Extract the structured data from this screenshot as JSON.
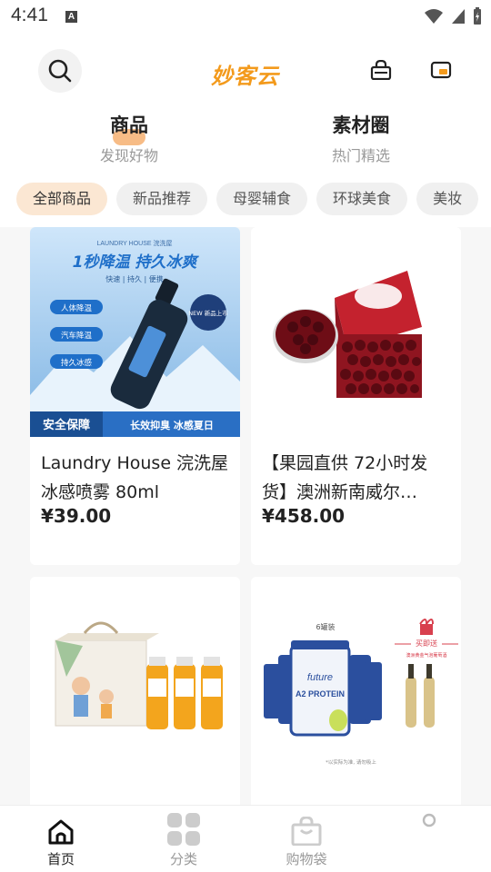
{
  "status": {
    "time": "4:41",
    "notif_glyph": "A"
  },
  "header": {
    "logo": "妙客云"
  },
  "main_tabs": [
    {
      "title": "商品",
      "subtitle": "发现好物"
    },
    {
      "title": "素材圈",
      "subtitle": "热门精选"
    }
  ],
  "chips": [
    "全部商品",
    "新品推荐",
    "母婴辅食",
    "环球美食",
    "美妆"
  ],
  "products": [
    {
      "title": "Laundry House 浣洗屋 冰感喷雾 80ml",
      "price": "¥39.00",
      "img": {
        "brand": "LAUNDRY HOUSE 浣洗屋",
        "headline": "1秒降温 持久冰爽",
        "sub": "快速 | 持久 | 便携",
        "tags": [
          "人体降温",
          "汽车降温",
          "持久冰感"
        ],
        "badge": "NEW 新品上市",
        "footer_left": "安全保障",
        "footer_right": "长效抑臭 冰感夏日"
      }
    },
    {
      "title": "【果园直供 72小时发货】澳洲新南威尔…",
      "price": "¥458.00",
      "img": {}
    },
    {
      "title": "",
      "price": "",
      "img": {}
    },
    {
      "title": "",
      "price": "",
      "img": {
        "top_label": "6罐装",
        "can_brand": "future",
        "can_text": "A2 PROTEIN",
        "gift": "买即送",
        "gift_sub": "澳洲黄金气泡葡萄酒",
        "footnote": "*以实际为准, 请勿吸上"
      }
    }
  ],
  "bottom_nav": [
    {
      "label": "首页",
      "icon": "home-icon"
    },
    {
      "label": "分类",
      "icon": "grid-icon"
    },
    {
      "label": "购物袋",
      "icon": "bag-icon"
    },
    {
      "label": "",
      "icon": "profile-icon"
    }
  ],
  "colors": {
    "accent": "#f39a1c",
    "chip_active": "#fbe7d3",
    "card_blue": "#3f8fd6"
  }
}
